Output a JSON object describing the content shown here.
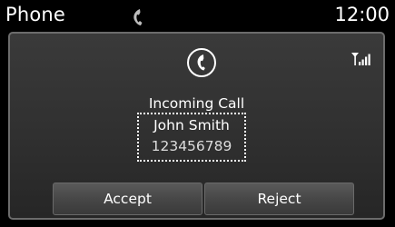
{
  "header": {
    "title": "Phone",
    "time": "12:00",
    "phone_icon": "handset-icon"
  },
  "call": {
    "status": "Incoming Call",
    "caller_name": "John Smith",
    "caller_number": "123456789",
    "call_icon": "incoming-call-icon",
    "signal_icon": "signal-strength-icon"
  },
  "actions": {
    "accept_label": "Accept",
    "reject_label": "Reject"
  },
  "colors": {
    "background": "#000000",
    "panel": "#333333",
    "text": "#ffffff"
  }
}
